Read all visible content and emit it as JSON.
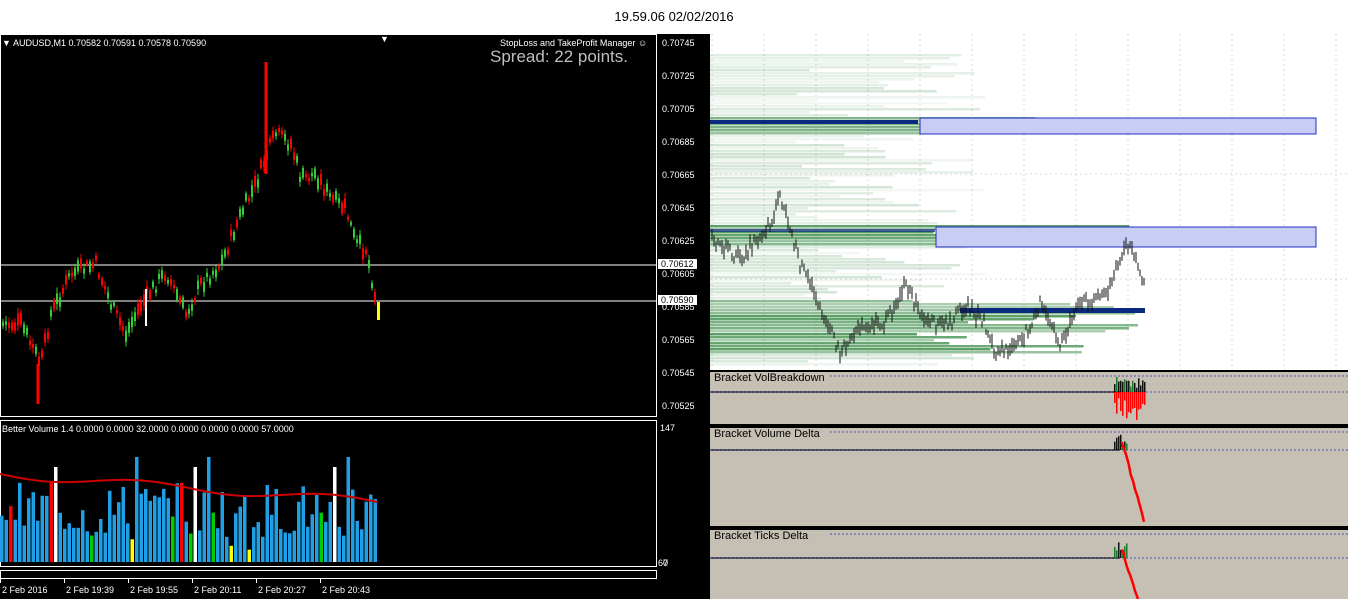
{
  "header": {
    "timestamp": "19.59.06 02/02/2016"
  },
  "mt4_chart": {
    "symbol_line": "AUDUSD,M1  0.70582 0.70591 0.70578 0.70590",
    "ea_label": "StopLoss and TakeProfit Manager",
    "spread_text": "Spread: 22 points.",
    "price_axis": [
      "0.70745",
      "0.70725",
      "0.70705",
      "0.70685",
      "0.70665",
      "0.70645",
      "0.70625",
      "0.70605",
      "0.70585",
      "0.70565",
      "0.70545",
      "0.70525"
    ],
    "tag_upper": "0.70612",
    "tag_lower": "0.70590",
    "colors": {
      "bull": "#33cc33",
      "bear": "#ff0000",
      "line": "#ffffff",
      "highlight": "#ffff00"
    }
  },
  "volume_panel": {
    "title": "Better Volume 1.4 0.0000 0.0000 32.0000 0.0000 0.0000 0.0000 57.0000",
    "axis_top": "147",
    "axis_bottom": "0",
    "axis_bottom_overlap": "67",
    "colors": {
      "normal": "#1e9fe6",
      "climax": "#ff0000",
      "churn": "#00cc00",
      "low": "#ffff00",
      "white": "#ffffff",
      "ma": "#cc0000"
    }
  },
  "time_axis": [
    "2 Feb 2016",
    "2 Feb 19:39",
    "2 Feb 19:55",
    "2 Feb 20:11",
    "2 Feb 20:27",
    "2 Feb 20:43"
  ],
  "right_chart": {
    "indicators": [
      {
        "title": "Bracket VolBreakdown"
      },
      {
        "title": "Bracket Volume Delta"
      },
      {
        "title": "Bracket Ticks Delta"
      }
    ],
    "colors": {
      "zone_fill": "#c8cdf5",
      "zone_border": "#2030c0",
      "poc": "#0a2a80",
      "profile": "#1a7a2a",
      "delta": "#ff0000",
      "panel_bg": "#c6bfb3"
    }
  }
}
